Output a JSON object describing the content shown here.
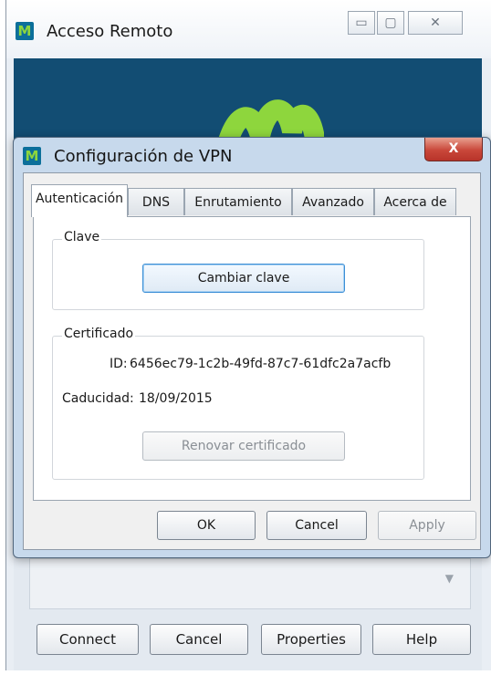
{
  "background_window": {
    "title": "Acceso Remoto",
    "logo_letter": "M",
    "buttons": {
      "connect": "Connect",
      "cancel": "Cancel",
      "properties": "Properties",
      "help": "Help"
    }
  },
  "dialog": {
    "title": "Configuración de VPN",
    "logo_letter": "M",
    "close_glyph": "X",
    "tabs": [
      {
        "label": "Autenticación",
        "active": true
      },
      {
        "label": "DNS",
        "active": false
      },
      {
        "label": "Enrutamiento",
        "active": false
      },
      {
        "label": "Avanzado",
        "active": false
      },
      {
        "label": "Acerca de",
        "active": false
      }
    ],
    "clave": {
      "legend": "Clave",
      "change_button": "Cambiar clave"
    },
    "certificado": {
      "legend": "Certificado",
      "id_label": "ID:",
      "id_value": "6456ec79-1c2b-49fd-87c7-61dfc2a7acfb",
      "expiry_label": "Caducidad:",
      "expiry_value": "18/09/2015",
      "renew_button": "Renovar certificado"
    },
    "footer": {
      "ok": "OK",
      "cancel": "Cancel",
      "apply": "Apply"
    }
  },
  "colors": {
    "brand_blue": "#124d73",
    "brand_green": "#8ed63d",
    "close_red": "#c9473a"
  },
  "icons": [
    "m-logo-icon",
    "minimize-icon",
    "maximize-icon",
    "close-icon",
    "dropdown-arrow-icon"
  ]
}
